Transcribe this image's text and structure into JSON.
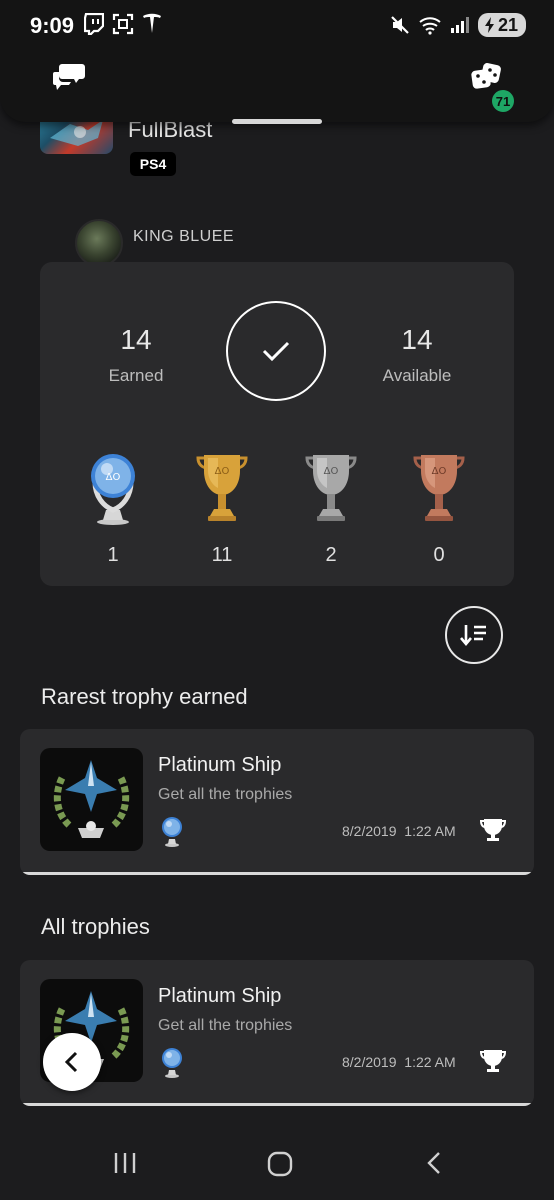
{
  "status_bar": {
    "time": "9:09",
    "battery": "21"
  },
  "header": {
    "left_icon": "chat-bubbles-icon",
    "right_icon": "game-library-icon",
    "notification_count": "71"
  },
  "game": {
    "title": "FullBlast",
    "platform": "PS4"
  },
  "user": {
    "name": "KING BLUEE"
  },
  "summary": {
    "earned": "14",
    "earned_label": "Earned",
    "available": "14",
    "available_label": "Available",
    "trophies": [
      {
        "type": "platinum",
        "count": "1"
      },
      {
        "type": "gold",
        "count": "11"
      },
      {
        "type": "silver",
        "count": "2"
      },
      {
        "type": "bronze",
        "count": "0"
      }
    ]
  },
  "sections": {
    "rarest": "Rarest trophy earned",
    "all": "All trophies"
  },
  "rarest_trophy": {
    "name": "Platinum Ship",
    "description": "Get all the trophies",
    "date": "8/2/2019",
    "time": "1:22 AM"
  },
  "all_trophies": [
    {
      "name": "Platinum Ship",
      "description": "Get all the trophies",
      "date": "8/2/2019",
      "time": "1:22 AM"
    }
  ],
  "colors": {
    "background": "#1c1c1e",
    "card": "#2a2a2c",
    "badge": "#1ea765",
    "platinum": "#7fb3e8",
    "gold": "#d8a23a",
    "silver": "#a8a8a8",
    "bronze": "#c27a5e"
  }
}
